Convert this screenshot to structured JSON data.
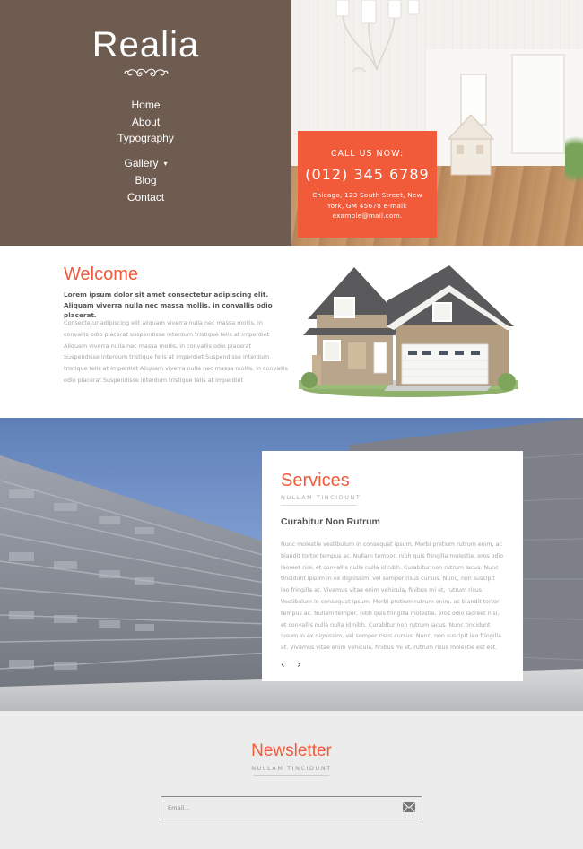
{
  "brand": {
    "name": "Realia",
    "ornament_icon": "swirl-ornament"
  },
  "nav": {
    "items": [
      {
        "label": "Home"
      },
      {
        "label": "About"
      },
      {
        "label": "Typography"
      },
      {
        "label": "Gallery",
        "caret": "▾"
      },
      {
        "label": "Blog"
      },
      {
        "label": "Contact"
      }
    ]
  },
  "call": {
    "title": "CALL US NOW:",
    "phone": "(012) 345 6789",
    "address": "Chicago, 123 South Street, New York, GM 45678 e-mail: example@mail.com."
  },
  "welcome": {
    "title": "Welcome",
    "lead": "Lorem ipsum dolor sit amet consectetur adipiscing elit. Aliquam viverra nulla nec massa mollis, in convallis odio placerat.",
    "body": "Consectetur adipiscing elit aliquam viverra nulla nec massa mollis, in convallis odio placerat suspendisse interdum tristique felis at imperdiet Aliquam viverra nulla nec massa mollis, in convallis odio placerat Suspendisse interdum tristique felis at imperdiet Suspendisse interdum tristique felis at imperdiet Aliquam viverra nulla nec massa mollis, in convallis odio placerat Suspendisse interdum tristique felis at imperdiet"
  },
  "services": {
    "title": "Services",
    "subtitle": "NULLAM TINCIDUNT",
    "heading": "Curabitur Non Rutrum",
    "body": "Nunc molestie vestibulum in consequat ipsum. Morbi pretium rutrum enim, ac blandit tortor tempus ac. Nullam tempor, nibh quis fringilla molestie, eros odio laoreet nisi, et convallis nulla nulla id nibh. Curabitur non rutrum lacus. Nunc tincidunt ipsum in ex dignissim, vel semper risus cursus. Nunc, non suscipit leo fringilla at. Vivamus vitae enim vehicula, finibus mi et, rutrum risus Vestibulum in consequat ipsum. Morbi pretium rutrum enim, ac blandit tortor tempus ac. Nullam tempor, nibh quis fringilla molestie, eros odio laoreet nisi, et convallis nulla nulla id nibh. Curabitur non rutrum lacus. Nunc tincidunt ipsum in ex dignissim, vel semper risus cursus. Nunc, non suscipit leo fringilla at. Vivamus vitae enim vehicula, finibus mi et, rutrum risus molestie est est.",
    "prev": "‹",
    "next": "›"
  },
  "newsletter": {
    "title": "Newsletter",
    "subtitle": "NULLAM TINCIDUNT",
    "placeholder": "Email...",
    "send_icon": "envelope-icon"
  },
  "colors": {
    "accent": "#f15b3a",
    "sidebar": "#6e5c50",
    "background": "#ececec"
  }
}
